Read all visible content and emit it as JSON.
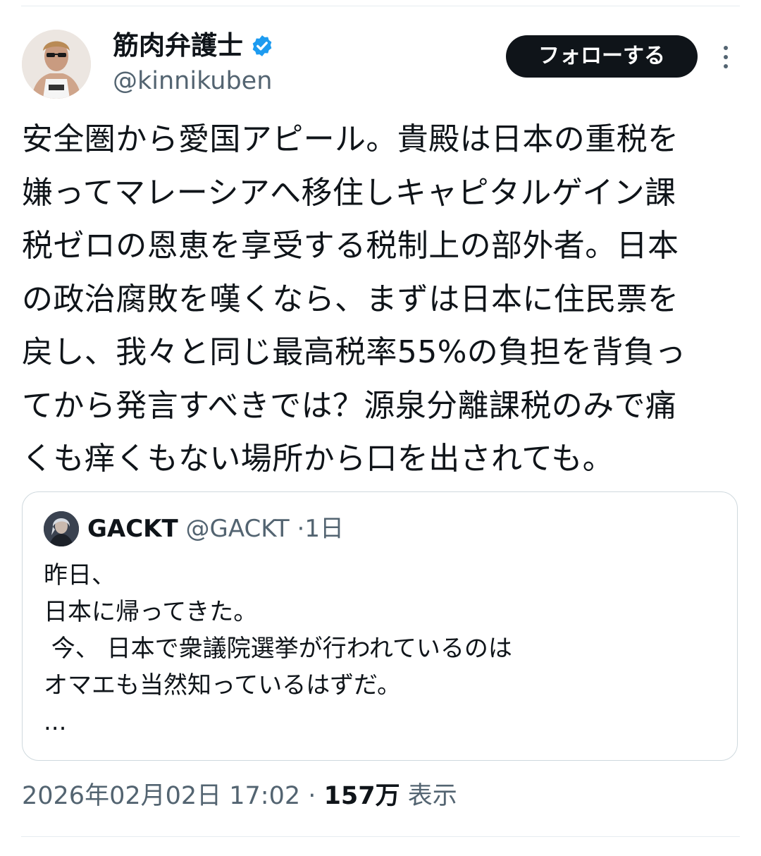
{
  "author": {
    "display_name": "筋肉弁護士",
    "handle": "@kinnikuben",
    "verified": true,
    "verified_color": "#1d9bf0"
  },
  "follow_button_label": "フォローする",
  "more_icon": "more-vertical-icon",
  "tweet_lines": [
    "安全圏から愛国アピール。貴殿は日本の重税を",
    "嫌ってマレーシアへ移住しキャピタルゲイン課",
    "税ゼロの恩恵を享受する税制上の部外者。日本",
    "の政治腐敗を嘆くなら、まずは日本に住民票を",
    "戻し、我々と同じ最高税率55%の負担を背負っ",
    "てから発言すべきでは？源泉分離課税のみで痛",
    "くも痒くもない場所から口を出されても。"
  ],
  "quote": {
    "name": "GACKT",
    "handle": "@GACKT",
    "separator": "·",
    "time": "1日",
    "lines": [
      "昨日、",
      "日本に帰ってきた。",
      " 今、 日本で衆議院選挙が行われているのは",
      "オマエも当然知っているはずだ。",
      "..."
    ]
  },
  "meta": {
    "timestamp": "2026年02月02日 17:02",
    "separator": "·",
    "views_count": "157万",
    "views_label": "表示"
  }
}
